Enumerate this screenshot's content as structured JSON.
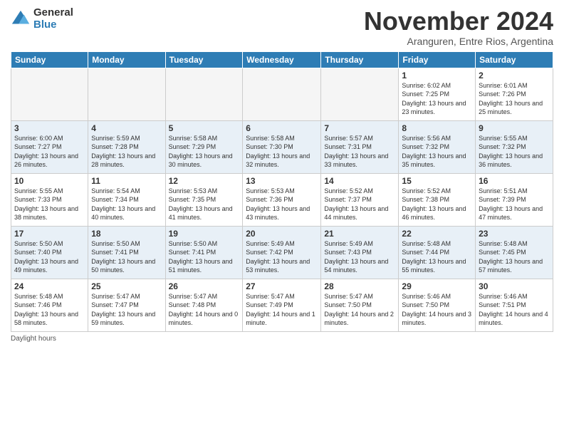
{
  "logo": {
    "general": "General",
    "blue": "Blue"
  },
  "title": "November 2024",
  "subtitle": "Aranguren, Entre Rios, Argentina",
  "days_header": [
    "Sunday",
    "Monday",
    "Tuesday",
    "Wednesday",
    "Thursday",
    "Friday",
    "Saturday"
  ],
  "footer_text": "Daylight hours",
  "weeks": [
    [
      {
        "day": "",
        "info": ""
      },
      {
        "day": "",
        "info": ""
      },
      {
        "day": "",
        "info": ""
      },
      {
        "day": "",
        "info": ""
      },
      {
        "day": "",
        "info": ""
      },
      {
        "day": "1",
        "info": "Sunrise: 6:02 AM\nSunset: 7:25 PM\nDaylight: 13 hours and 23 minutes."
      },
      {
        "day": "2",
        "info": "Sunrise: 6:01 AM\nSunset: 7:26 PM\nDaylight: 13 hours and 25 minutes."
      }
    ],
    [
      {
        "day": "3",
        "info": "Sunrise: 6:00 AM\nSunset: 7:27 PM\nDaylight: 13 hours and 26 minutes."
      },
      {
        "day": "4",
        "info": "Sunrise: 5:59 AM\nSunset: 7:28 PM\nDaylight: 13 hours and 28 minutes."
      },
      {
        "day": "5",
        "info": "Sunrise: 5:58 AM\nSunset: 7:29 PM\nDaylight: 13 hours and 30 minutes."
      },
      {
        "day": "6",
        "info": "Sunrise: 5:58 AM\nSunset: 7:30 PM\nDaylight: 13 hours and 32 minutes."
      },
      {
        "day": "7",
        "info": "Sunrise: 5:57 AM\nSunset: 7:31 PM\nDaylight: 13 hours and 33 minutes."
      },
      {
        "day": "8",
        "info": "Sunrise: 5:56 AM\nSunset: 7:32 PM\nDaylight: 13 hours and 35 minutes."
      },
      {
        "day": "9",
        "info": "Sunrise: 5:55 AM\nSunset: 7:32 PM\nDaylight: 13 hours and 36 minutes."
      }
    ],
    [
      {
        "day": "10",
        "info": "Sunrise: 5:55 AM\nSunset: 7:33 PM\nDaylight: 13 hours and 38 minutes."
      },
      {
        "day": "11",
        "info": "Sunrise: 5:54 AM\nSunset: 7:34 PM\nDaylight: 13 hours and 40 minutes."
      },
      {
        "day": "12",
        "info": "Sunrise: 5:53 AM\nSunset: 7:35 PM\nDaylight: 13 hours and 41 minutes."
      },
      {
        "day": "13",
        "info": "Sunrise: 5:53 AM\nSunset: 7:36 PM\nDaylight: 13 hours and 43 minutes."
      },
      {
        "day": "14",
        "info": "Sunrise: 5:52 AM\nSunset: 7:37 PM\nDaylight: 13 hours and 44 minutes."
      },
      {
        "day": "15",
        "info": "Sunrise: 5:52 AM\nSunset: 7:38 PM\nDaylight: 13 hours and 46 minutes."
      },
      {
        "day": "16",
        "info": "Sunrise: 5:51 AM\nSunset: 7:39 PM\nDaylight: 13 hours and 47 minutes."
      }
    ],
    [
      {
        "day": "17",
        "info": "Sunrise: 5:50 AM\nSunset: 7:40 PM\nDaylight: 13 hours and 49 minutes."
      },
      {
        "day": "18",
        "info": "Sunrise: 5:50 AM\nSunset: 7:41 PM\nDaylight: 13 hours and 50 minutes."
      },
      {
        "day": "19",
        "info": "Sunrise: 5:50 AM\nSunset: 7:41 PM\nDaylight: 13 hours and 51 minutes."
      },
      {
        "day": "20",
        "info": "Sunrise: 5:49 AM\nSunset: 7:42 PM\nDaylight: 13 hours and 53 minutes."
      },
      {
        "day": "21",
        "info": "Sunrise: 5:49 AM\nSunset: 7:43 PM\nDaylight: 13 hours and 54 minutes."
      },
      {
        "day": "22",
        "info": "Sunrise: 5:48 AM\nSunset: 7:44 PM\nDaylight: 13 hours and 55 minutes."
      },
      {
        "day": "23",
        "info": "Sunrise: 5:48 AM\nSunset: 7:45 PM\nDaylight: 13 hours and 57 minutes."
      }
    ],
    [
      {
        "day": "24",
        "info": "Sunrise: 5:48 AM\nSunset: 7:46 PM\nDaylight: 13 hours and 58 minutes."
      },
      {
        "day": "25",
        "info": "Sunrise: 5:47 AM\nSunset: 7:47 PM\nDaylight: 13 hours and 59 minutes."
      },
      {
        "day": "26",
        "info": "Sunrise: 5:47 AM\nSunset: 7:48 PM\nDaylight: 14 hours and 0 minutes."
      },
      {
        "day": "27",
        "info": "Sunrise: 5:47 AM\nSunset: 7:49 PM\nDaylight: 14 hours and 1 minute."
      },
      {
        "day": "28",
        "info": "Sunrise: 5:47 AM\nSunset: 7:50 PM\nDaylight: 14 hours and 2 minutes."
      },
      {
        "day": "29",
        "info": "Sunrise: 5:46 AM\nSunset: 7:50 PM\nDaylight: 14 hours and 3 minutes."
      },
      {
        "day": "30",
        "info": "Sunrise: 5:46 AM\nSunset: 7:51 PM\nDaylight: 14 hours and 4 minutes."
      }
    ]
  ]
}
